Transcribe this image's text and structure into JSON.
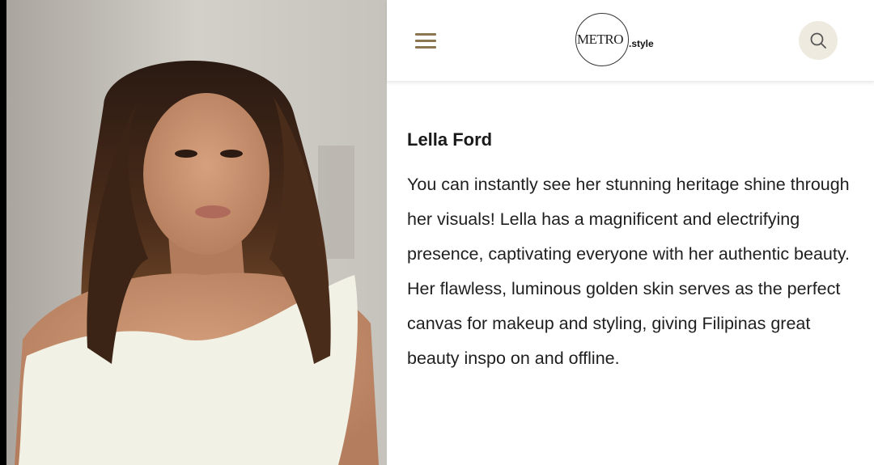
{
  "header": {
    "logo_main": "METRO",
    "logo_suffix": ".style",
    "menu_icon": "hamburger-menu-icon",
    "search_icon": "search-icon"
  },
  "article": {
    "name": "Lella Ford",
    "body": "You can instantly see her stunning heritage shine through her visuals! Lella has a magnificent and electrifying presence, captivating everyone with her authentic beauty. Her flawless, luminous golden skin serves as the perfect canvas for makeup and styling, giving Filipinas great beauty inspo on and offline."
  },
  "colors": {
    "accent": "#8a7650",
    "search_bg": "#efeae0",
    "text": "#1f1f1f"
  }
}
